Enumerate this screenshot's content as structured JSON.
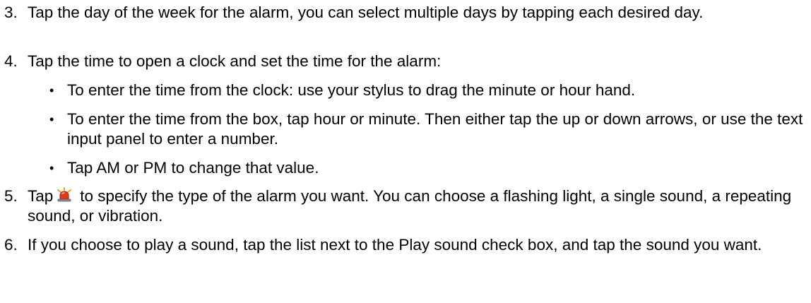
{
  "steps": [
    {
      "number": "3.",
      "text": "Tap the day of the week for the alarm, you can select multiple days by tapping each desired day."
    },
    {
      "number": "4.",
      "text": "Tap the time to open a clock and set the time for the alarm:"
    },
    {
      "number": "5.",
      "text_before_icon": "Tap",
      "icon": "alarm-bell-icon",
      "text_after_icon": "to specify the type of the alarm you want. You can choose a flashing light, a single sound, a repeating sound, or vibration."
    },
    {
      "number": "6.",
      "text": "If you choose to play a sound, tap the list next to the Play sound check box, and tap the sound you want."
    }
  ],
  "bullets": [
    {
      "symbol": "•",
      "text": "To enter the time from the clock: use your stylus to drag the minute or hour hand."
    },
    {
      "symbol": "•",
      "text": "To enter the time from the box, tap hour or minute. Then either tap the up or down arrows, or use the text input panel to enter a number."
    },
    {
      "symbol": "•",
      "text": "Tap AM or PM to change that value."
    }
  ]
}
